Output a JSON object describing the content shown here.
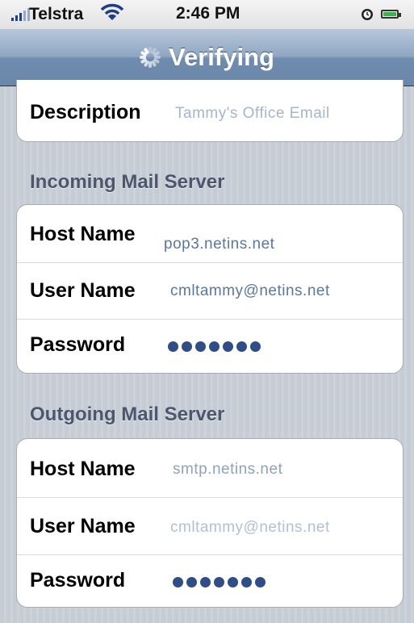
{
  "status_bar": {
    "carrier": "Telstra",
    "time": "2:46 PM",
    "battery_level": 0.9
  },
  "nav": {
    "title": "Verifying"
  },
  "description": {
    "label": "Description",
    "value": "Tammy's Office Email"
  },
  "incoming": {
    "header": "Incoming Mail Server",
    "host_label": "Host Name",
    "host_value": "pop3.netins.net",
    "user_label": "User Name",
    "user_value": "cmltammy@netins.net",
    "password_label": "Password",
    "password_length": 7
  },
  "outgoing": {
    "header": "Outgoing Mail Server",
    "host_label": "Host Name",
    "host_value": "smtp.netins.net",
    "user_label": "User Name",
    "user_value": "cmltammy@netins.net",
    "password_label": "Password",
    "password_length": 7
  }
}
